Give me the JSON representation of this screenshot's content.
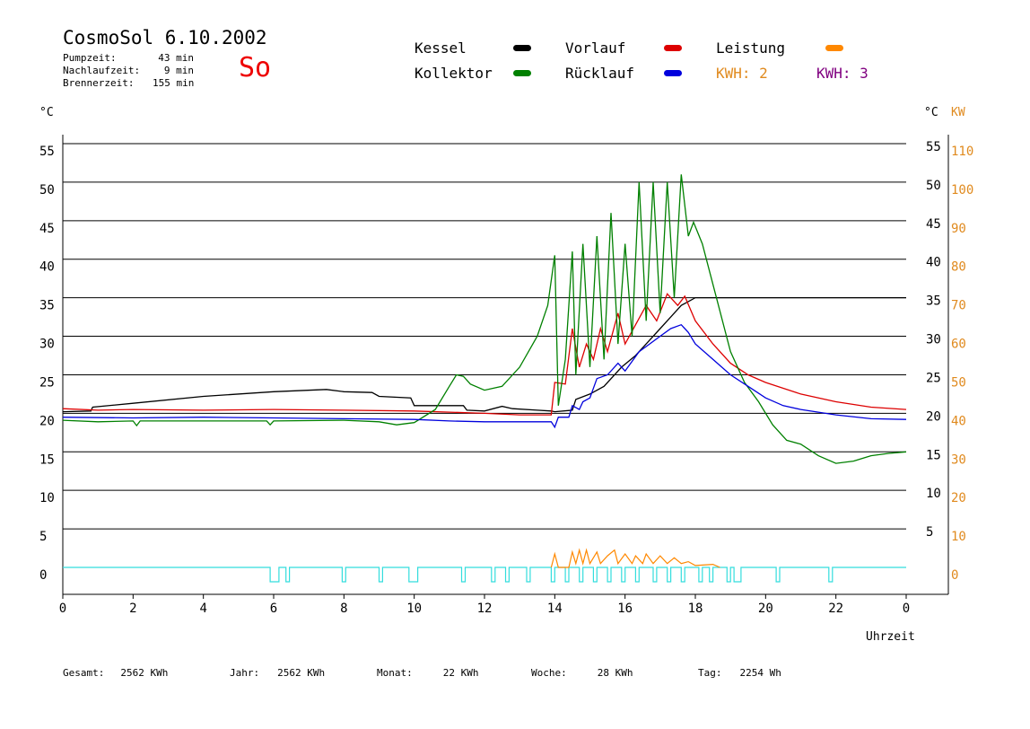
{
  "header": {
    "title": "CosmoSol 6.10.2002",
    "weekday": "So",
    "stats": [
      {
        "label": "Pumpzeit:",
        "value": "43 min"
      },
      {
        "label": "Nachlaufzeit:",
        "value": "9 min"
      },
      {
        "label": "Brennerzeit:",
        "value": "155 min"
      }
    ]
  },
  "legend": [
    {
      "label": "Kessel",
      "color": "#000000"
    },
    {
      "label": "Vorlauf",
      "color": "#dd0000"
    },
    {
      "label": "Leistung",
      "color": "#ff8800"
    },
    {
      "label": "Kollektor",
      "color": "#008000"
    },
    {
      "label": "Rücklauf",
      "color": "#0000dd"
    },
    {
      "label": "KWH: 2",
      "color": "#e08a1e"
    },
    {
      "label": "KWH: 3",
      "color": "#800080"
    }
  ],
  "axes": {
    "left_unit": "°C",
    "right_unit_c": "°C",
    "right_unit_kw": "KW",
    "x_label": "Uhrzeit",
    "left_ticks": [
      "0",
      "5",
      "10",
      "15",
      "20",
      "25",
      "30",
      "35",
      "40",
      "45",
      "50",
      "55"
    ],
    "right_ticks_c": [
      "5",
      "10",
      "15",
      "20",
      "25",
      "30",
      "35",
      "40",
      "45",
      "50",
      "55"
    ],
    "right_ticks_kw": [
      "0",
      "10",
      "20",
      "30",
      "40",
      "50",
      "60",
      "70",
      "80",
      "90",
      "100",
      "110"
    ],
    "x_ticks": [
      "0",
      "2",
      "4",
      "6",
      "8",
      "10",
      "12",
      "14",
      "16",
      "18",
      "20",
      "22",
      "0"
    ]
  },
  "footer": [
    {
      "label": "Gesamt:",
      "value": "2562 KWh"
    },
    {
      "label": "Jahr:",
      "value": "2562 KWh"
    },
    {
      "label": "Monat:",
      "value": "22 KWh"
    },
    {
      "label": "Woche:",
      "value": "28 KWh"
    },
    {
      "label": "Tag:",
      "value": "2254 Wh"
    }
  ],
  "chart_data": {
    "type": "line",
    "title": "CosmoSol 6.10.2002",
    "xlabel": "Uhrzeit",
    "ylabel": "°C",
    "y2label": "KW",
    "xlim": [
      0,
      24
    ],
    "ylim": [
      0,
      55
    ],
    "y2lim": [
      0,
      110
    ],
    "grid": true,
    "series": [
      {
        "name": "Kessel",
        "color": "#000000",
        "points": [
          [
            0,
            20.2
          ],
          [
            0.8,
            20.3
          ],
          [
            0.85,
            20.8
          ],
          [
            2,
            21.3
          ],
          [
            4,
            22.2
          ],
          [
            6,
            22.8
          ],
          [
            7.5,
            23.1
          ],
          [
            8,
            22.8
          ],
          [
            8.8,
            22.7
          ],
          [
            9,
            22.2
          ],
          [
            9.9,
            22.0
          ],
          [
            10,
            21.0
          ],
          [
            11.4,
            21.0
          ],
          [
            11.5,
            20.4
          ],
          [
            12,
            20.3
          ],
          [
            12.5,
            20.9
          ],
          [
            12.8,
            20.6
          ],
          [
            13.5,
            20.4
          ],
          [
            13.9,
            20.3
          ],
          [
            14,
            20.2
          ],
          [
            14.5,
            20.4
          ],
          [
            14.6,
            21.8
          ],
          [
            15,
            22.5
          ],
          [
            15.4,
            23.5
          ],
          [
            15.9,
            26.0
          ],
          [
            16.3,
            27.5
          ],
          [
            16.6,
            29.0
          ],
          [
            17,
            31.0
          ],
          [
            17.3,
            32.5
          ],
          [
            17.6,
            34.0
          ],
          [
            18,
            35.0
          ],
          [
            19,
            35.0
          ],
          [
            20,
            35.0
          ],
          [
            22,
            35.0
          ],
          [
            24,
            35.0
          ]
        ]
      },
      {
        "name": "Vorlauf",
        "color": "#dd0000",
        "points": [
          [
            0,
            20.6
          ],
          [
            1,
            20.4
          ],
          [
            2,
            20.5
          ],
          [
            4,
            20.4
          ],
          [
            6,
            20.5
          ],
          [
            8,
            20.4
          ],
          [
            10,
            20.3
          ],
          [
            12,
            20.0
          ],
          [
            13,
            19.8
          ],
          [
            13.9,
            19.8
          ],
          [
            14,
            24.0
          ],
          [
            14.3,
            23.8
          ],
          [
            14.5,
            31.0
          ],
          [
            14.7,
            26.0
          ],
          [
            14.9,
            29.0
          ],
          [
            15.1,
            27.0
          ],
          [
            15.3,
            31.0
          ],
          [
            15.5,
            28.0
          ],
          [
            15.8,
            33.0
          ],
          [
            16,
            29.0
          ],
          [
            16.3,
            31.5
          ],
          [
            16.6,
            34.0
          ],
          [
            16.9,
            32.0
          ],
          [
            17.2,
            35.5
          ],
          [
            17.5,
            34.0
          ],
          [
            17.7,
            35.2
          ],
          [
            18,
            32.0
          ],
          [
            18.5,
            29.0
          ],
          [
            19,
            26.5
          ],
          [
            19.5,
            25.0
          ],
          [
            20,
            24.0
          ],
          [
            21,
            22.5
          ],
          [
            22,
            21.5
          ],
          [
            23,
            20.8
          ],
          [
            24,
            20.5
          ]
        ]
      },
      {
        "name": "Kollektor",
        "color": "#008000",
        "points": [
          [
            0,
            19.1
          ],
          [
            1,
            18.9
          ],
          [
            2,
            19.0
          ],
          [
            2.1,
            18.4
          ],
          [
            2.2,
            19.0
          ],
          [
            4,
            19.0
          ],
          [
            5.8,
            19.0
          ],
          [
            5.9,
            18.5
          ],
          [
            6,
            19.0
          ],
          [
            8,
            19.1
          ],
          [
            9,
            18.9
          ],
          [
            9.5,
            18.5
          ],
          [
            10,
            18.8
          ],
          [
            10.6,
            20.5
          ],
          [
            11,
            23.5
          ],
          [
            11.2,
            25.0
          ],
          [
            11.4,
            24.8
          ],
          [
            11.6,
            23.8
          ],
          [
            12,
            23.0
          ],
          [
            12.5,
            23.5
          ],
          [
            13,
            26.0
          ],
          [
            13.5,
            30.0
          ],
          [
            13.8,
            34.0
          ],
          [
            14,
            40.5
          ],
          [
            14.1,
            21.0
          ],
          [
            14.3,
            27.0
          ],
          [
            14.5,
            41.0
          ],
          [
            14.6,
            25.0
          ],
          [
            14.8,
            42.0
          ],
          [
            15,
            26.0
          ],
          [
            15.2,
            43.0
          ],
          [
            15.4,
            27.0
          ],
          [
            15.6,
            46.0
          ],
          [
            15.8,
            29.0
          ],
          [
            16,
            42.0
          ],
          [
            16.2,
            30.0
          ],
          [
            16.4,
            50.0
          ],
          [
            16.6,
            32.0
          ],
          [
            16.8,
            50.0
          ],
          [
            17,
            33.0
          ],
          [
            17.2,
            50.0
          ],
          [
            17.4,
            35.0
          ],
          [
            17.6,
            51.0
          ],
          [
            17.8,
            43.0
          ],
          [
            17.95,
            44.8
          ],
          [
            18.2,
            42.0
          ],
          [
            18.6,
            35.0
          ],
          [
            19,
            28.0
          ],
          [
            19.4,
            24.0
          ],
          [
            19.8,
            21.5
          ],
          [
            20.2,
            18.5
          ],
          [
            20.6,
            16.5
          ],
          [
            21,
            16.0
          ],
          [
            21.5,
            14.5
          ],
          [
            22,
            13.5
          ],
          [
            22.5,
            13.8
          ],
          [
            23,
            14.5
          ],
          [
            23.5,
            14.8
          ],
          [
            24,
            15.0
          ]
        ]
      },
      {
        "name": "Rücklauf",
        "color": "#0000dd",
        "points": [
          [
            0,
            19.5
          ],
          [
            2,
            19.4
          ],
          [
            4,
            19.5
          ],
          [
            6,
            19.4
          ],
          [
            8,
            19.3
          ],
          [
            10,
            19.2
          ],
          [
            11,
            19.0
          ],
          [
            12,
            18.9
          ],
          [
            13.9,
            18.9
          ],
          [
            14,
            18.2
          ],
          [
            14.1,
            19.5
          ],
          [
            14.4,
            19.5
          ],
          [
            14.5,
            21.0
          ],
          [
            14.7,
            20.5
          ],
          [
            14.8,
            21.5
          ],
          [
            15,
            22.0
          ],
          [
            15.2,
            24.5
          ],
          [
            15.5,
            25.0
          ],
          [
            15.8,
            26.5
          ],
          [
            16,
            25.5
          ],
          [
            16.4,
            28.0
          ],
          [
            16.7,
            29.0
          ],
          [
            17,
            30.0
          ],
          [
            17.3,
            31.0
          ],
          [
            17.6,
            31.5
          ],
          [
            17.8,
            30.5
          ],
          [
            18,
            29.0
          ],
          [
            18.5,
            27.0
          ],
          [
            19,
            25.0
          ],
          [
            19.5,
            23.5
          ],
          [
            20,
            22.0
          ],
          [
            20.5,
            21.0
          ],
          [
            21,
            20.5
          ],
          [
            22,
            19.8
          ],
          [
            23,
            19.3
          ],
          [
            24,
            19.2
          ]
        ]
      }
    ],
    "leistung_kw": {
      "name": "Leistung",
      "color": "#ff8800",
      "points": [
        [
          13.9,
          0
        ],
        [
          14,
          3.5
        ],
        [
          14.1,
          0
        ],
        [
          14.4,
          0
        ],
        [
          14.5,
          4.0
        ],
        [
          14.6,
          1.0
        ],
        [
          14.7,
          4.5
        ],
        [
          14.8,
          1.0
        ],
        [
          14.9,
          4.5
        ],
        [
          15,
          1.0
        ],
        [
          15.2,
          4.0
        ],
        [
          15.3,
          1.0
        ],
        [
          15.5,
          3.0
        ],
        [
          15.7,
          4.5
        ],
        [
          15.8,
          1.0
        ],
        [
          16,
          3.5
        ],
        [
          16.2,
          1.0
        ],
        [
          16.3,
          3.0
        ],
        [
          16.5,
          1.0
        ],
        [
          16.6,
          3.5
        ],
        [
          16.8,
          1.0
        ],
        [
          17,
          3.0
        ],
        [
          17.2,
          1.0
        ],
        [
          17.4,
          2.5
        ],
        [
          17.6,
          1.0
        ],
        [
          17.8,
          1.5
        ],
        [
          18,
          0.5
        ],
        [
          18.5,
          0.8
        ],
        [
          18.7,
          0
        ]
      ]
    },
    "pump_pulses_h": [
      [
        5.9,
        6.15
      ],
      [
        6.35,
        6.45
      ],
      [
        7.95,
        8.05
      ],
      [
        9,
        9.1
      ],
      [
        9.85,
        10.1
      ],
      [
        11.35,
        11.45
      ],
      [
        12.2,
        12.3
      ],
      [
        12.6,
        12.7
      ],
      [
        13.2,
        13.3
      ],
      [
        13.9,
        14.0
      ],
      [
        14.3,
        14.4
      ],
      [
        14.7,
        14.8
      ],
      [
        15.1,
        15.2
      ],
      [
        15.5,
        15.6
      ],
      [
        15.9,
        16.0
      ],
      [
        16.3,
        16.4
      ],
      [
        16.8,
        16.9
      ],
      [
        17.2,
        17.3
      ],
      [
        17.6,
        17.7
      ],
      [
        18.1,
        18.2
      ],
      [
        18.4,
        18.5
      ],
      [
        18.9,
        19.0
      ],
      [
        19.1,
        19.3
      ],
      [
        20.3,
        20.4
      ],
      [
        21.8,
        21.9
      ]
    ]
  }
}
